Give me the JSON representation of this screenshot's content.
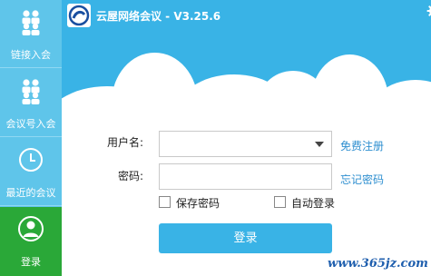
{
  "app": {
    "title": "云屋网络会议 - V3.25.6"
  },
  "sidebar": {
    "items": [
      {
        "label": "链接入会",
        "icon": "people-group-icon"
      },
      {
        "label": "会议号入会",
        "icon": "people-group-icon"
      },
      {
        "label": "最近的会议",
        "icon": "clock-icon"
      },
      {
        "label": "登录",
        "icon": "user-icon",
        "active": true
      }
    ]
  },
  "form": {
    "username_label": "用户名:",
    "username_value": "",
    "password_label": "密码:",
    "password_value": "",
    "register_link": "免费注册",
    "forgot_link": "忘记密码",
    "remember_label": "保存密码",
    "remember_checked": false,
    "auto_login_label": "自动登录",
    "auto_login_checked": false,
    "login_button": "登录"
  },
  "watermark": "www.365jz.com",
  "colors": {
    "sidebar": "#5fc5ea",
    "active_tab": "#2aa838",
    "banner": "#39b3e6",
    "button": "#39b3e6",
    "link": "#2f8fd0"
  }
}
